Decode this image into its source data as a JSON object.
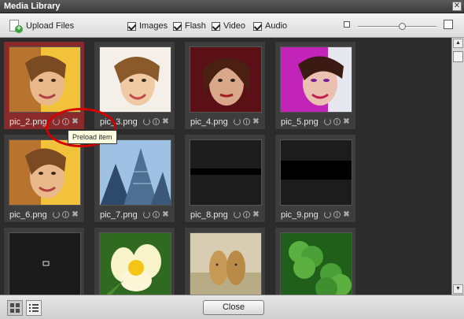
{
  "window": {
    "title": "Media Library",
    "close_glyph": "✕"
  },
  "toolbar": {
    "upload_label": "Upload Files",
    "filters": [
      {
        "label": "Images",
        "checked": true
      },
      {
        "label": "Flash",
        "checked": true
      },
      {
        "label": "Video",
        "checked": true
      },
      {
        "label": "Audio",
        "checked": true
      }
    ],
    "thumb_size_fraction": 0.56
  },
  "items": [
    {
      "name": "pic_2.png",
      "selected": true,
      "thumb": "portrait-warm"
    },
    {
      "name": "pic_3.png",
      "selected": false,
      "thumb": "portrait-light"
    },
    {
      "name": "pic_4.png",
      "selected": false,
      "thumb": "portrait-red"
    },
    {
      "name": "pic_5.png",
      "selected": false,
      "thumb": "portrait-magenta"
    },
    {
      "name": "pic_6.png",
      "selected": false,
      "thumb": "portrait-warm"
    },
    {
      "name": "pic_7.png",
      "selected": false,
      "thumb": "skyscrapers"
    },
    {
      "name": "pic_8.png",
      "selected": false,
      "thumb": "black-stripe"
    },
    {
      "name": "pic_9.png",
      "selected": false,
      "thumb": "black-band"
    },
    {
      "name": "",
      "selected": false,
      "thumb": "empty-placeholder"
    },
    {
      "name": "",
      "selected": false,
      "thumb": "flower"
    },
    {
      "name": "",
      "selected": false,
      "thumb": "cheetahs"
    },
    {
      "name": "",
      "selected": false,
      "thumb": "clover"
    }
  ],
  "tooltip": {
    "text": "Preload item"
  },
  "footer": {
    "close_label": "Close"
  },
  "colors": {
    "selected_tile": "#8b2a2a",
    "highlight_ring": "#d40000"
  }
}
